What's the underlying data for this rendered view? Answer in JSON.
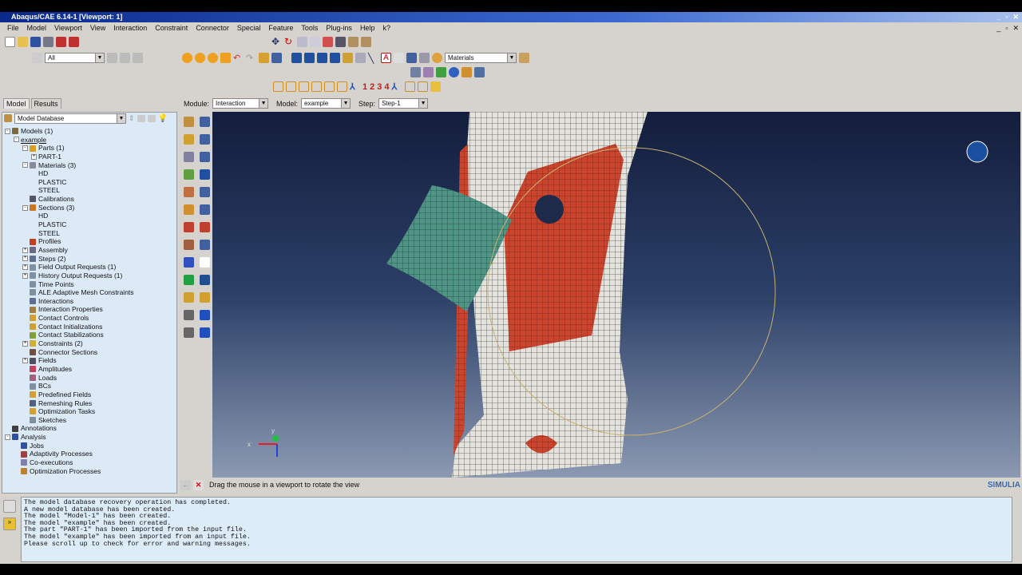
{
  "window": {
    "title": "Abaqus/CAE 6.14-1 [Viewport: 1]"
  },
  "menu": [
    "File",
    "Model",
    "Viewport",
    "View",
    "Interaction",
    "Constraint",
    "Connector",
    "Special",
    "Feature",
    "Tools",
    "Plug-ins",
    "Help",
    "k?"
  ],
  "toolbar": {
    "selection_filter": "All",
    "render_style": "Materials",
    "view_numbers": [
      "1",
      "2",
      "3",
      "4"
    ]
  },
  "tabs": [
    "Model",
    "Results"
  ],
  "context": {
    "module_label": "Module:",
    "module": "Interaction",
    "model_label": "Model:",
    "model": "example",
    "step_label": "Step:",
    "step": "Step-1"
  },
  "tree": {
    "selector": "Model Database",
    "items": [
      {
        "label": "Models (1)",
        "depth": 0,
        "exp": "-",
        "color": "#7a6a40"
      },
      {
        "label": "example",
        "depth": 1,
        "exp": "-",
        "underline": true
      },
      {
        "label": "Parts (1)",
        "depth": 2,
        "exp": "-",
        "color": "#d8a020"
      },
      {
        "label": "PART-1",
        "depth": 3,
        "exp": "+"
      },
      {
        "label": "Materials (3)",
        "depth": 2,
        "exp": "-",
        "color": "#8a8a9a"
      },
      {
        "label": "HD",
        "depth": 3
      },
      {
        "label": "PLASTIC",
        "depth": 3
      },
      {
        "label": "STEEL",
        "depth": 3
      },
      {
        "label": "Calibrations",
        "depth": 2,
        "color": "#556"
      },
      {
        "label": "Sections (3)",
        "depth": 2,
        "exp": "-",
        "color": "#c87820"
      },
      {
        "label": "HD",
        "depth": 3
      },
      {
        "label": "PLASTIC",
        "depth": 3
      },
      {
        "label": "STEEL",
        "depth": 3
      },
      {
        "label": "Profiles",
        "depth": 2,
        "color": "#c04020"
      },
      {
        "label": "Assembly",
        "depth": 2,
        "exp": "+",
        "color": "#6a6a80"
      },
      {
        "label": "Steps (2)",
        "depth": 2,
        "exp": "+",
        "color": "#607090"
      },
      {
        "label": "Field Output Requests (1)",
        "depth": 2,
        "exp": "+",
        "color": "#8090a0"
      },
      {
        "label": "History Output Requests (1)",
        "depth": 2,
        "exp": "+",
        "color": "#8090a0"
      },
      {
        "label": "Time Points",
        "depth": 2,
        "color": "#8090a0"
      },
      {
        "label": "ALE Adaptive Mesh Constraints",
        "depth": 2,
        "color": "#8090a0"
      },
      {
        "label": "Interactions",
        "depth": 2,
        "color": "#607090"
      },
      {
        "label": "Interaction Properties",
        "depth": 2,
        "color": "#a08040"
      },
      {
        "label": "Contact Controls",
        "depth": 2,
        "color": "#d0a030"
      },
      {
        "label": "Contact Initializations",
        "depth": 2,
        "color": "#d0a030"
      },
      {
        "label": "Contact Stabilizations",
        "depth": 2,
        "color": "#80a040"
      },
      {
        "label": "Constraints (2)",
        "depth": 2,
        "exp": "+",
        "color": "#d0b030"
      },
      {
        "label": "Connector Sections",
        "depth": 2,
        "color": "#705040"
      },
      {
        "label": "Fields",
        "depth": 2,
        "exp": "+",
        "color": "#505060"
      },
      {
        "label": "Amplitudes",
        "depth": 2,
        "color": "#c04060"
      },
      {
        "label": "Loads",
        "depth": 2,
        "color": "#a06080"
      },
      {
        "label": "BCs",
        "depth": 2,
        "color": "#8090a0"
      },
      {
        "label": "Predefined Fields",
        "depth": 2,
        "color": "#d0a030"
      },
      {
        "label": "Remeshing Rules",
        "depth": 2,
        "color": "#506080"
      },
      {
        "label": "Optimization Tasks",
        "depth": 2,
        "color": "#d0a030"
      },
      {
        "label": "Sketches",
        "depth": 2,
        "color": "#8090a0"
      },
      {
        "label": "Annotations",
        "depth": 0,
        "color": "#404040"
      },
      {
        "label": "Analysis",
        "depth": 0,
        "exp": "-",
        "color": "#3050a0"
      },
      {
        "label": "Jobs",
        "depth": 1,
        "color": "#3050a0"
      },
      {
        "label": "Adaptivity Processes",
        "depth": 1,
        "color": "#a04040"
      },
      {
        "label": "Co-executions",
        "depth": 1,
        "color": "#8080b0"
      },
      {
        "label": "Optimization Processes",
        "depth": 1,
        "color": "#c08030"
      }
    ]
  },
  "prompt": "Drag the mouse in a viewport to rotate the view",
  "brand": "SIMULIA",
  "messages": [
    "The model database recovery operation has completed.",
    "A new model database has been created.",
    "The model \"Model-1\" has been created.",
    "The model \"example\" has been created.",
    "The part \"PART-1\" has been imported from the input file.",
    "The model \"example\" has been imported from an input file.",
    "Please scroll up to check for error and warning messages."
  ],
  "triad": {
    "x": "x",
    "y": "y"
  }
}
